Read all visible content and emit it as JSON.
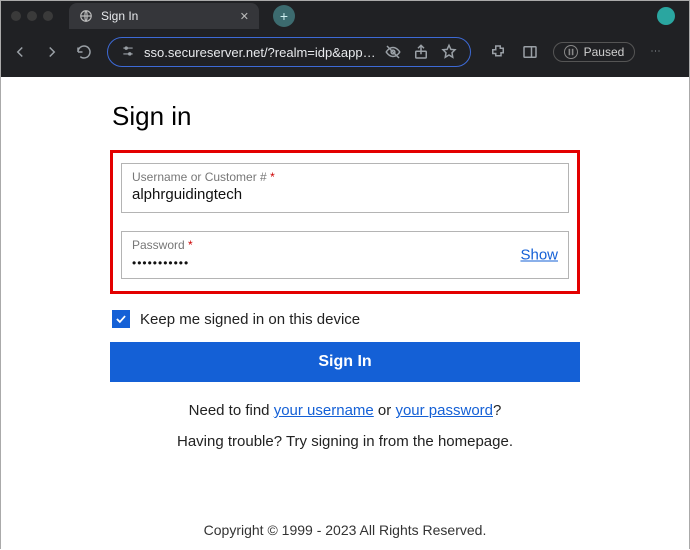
{
  "browser": {
    "tab_title": "Sign In",
    "url": "sso.secureserver.net/?realm=idp&app…",
    "paused_label": "Paused"
  },
  "page": {
    "heading": "Sign in",
    "username_label": "Username or Customer #",
    "required_mark": "*",
    "username_value": "alphrguidingtech",
    "password_label": "Password",
    "password_masked": "•••••••••••",
    "show_label": "Show",
    "keep_signed_label": "Keep me signed in on this device",
    "signin_button": "Sign In",
    "helper_prefix": "Need to find ",
    "helper_username_link": "your username",
    "helper_or": " or ",
    "helper_password_link": "your password",
    "helper_suffix": "?",
    "trouble_text": "Having trouble? Try signing in from the homepage.",
    "copyright": "Copyright © 1999 - 2023 All Rights Reserved."
  }
}
